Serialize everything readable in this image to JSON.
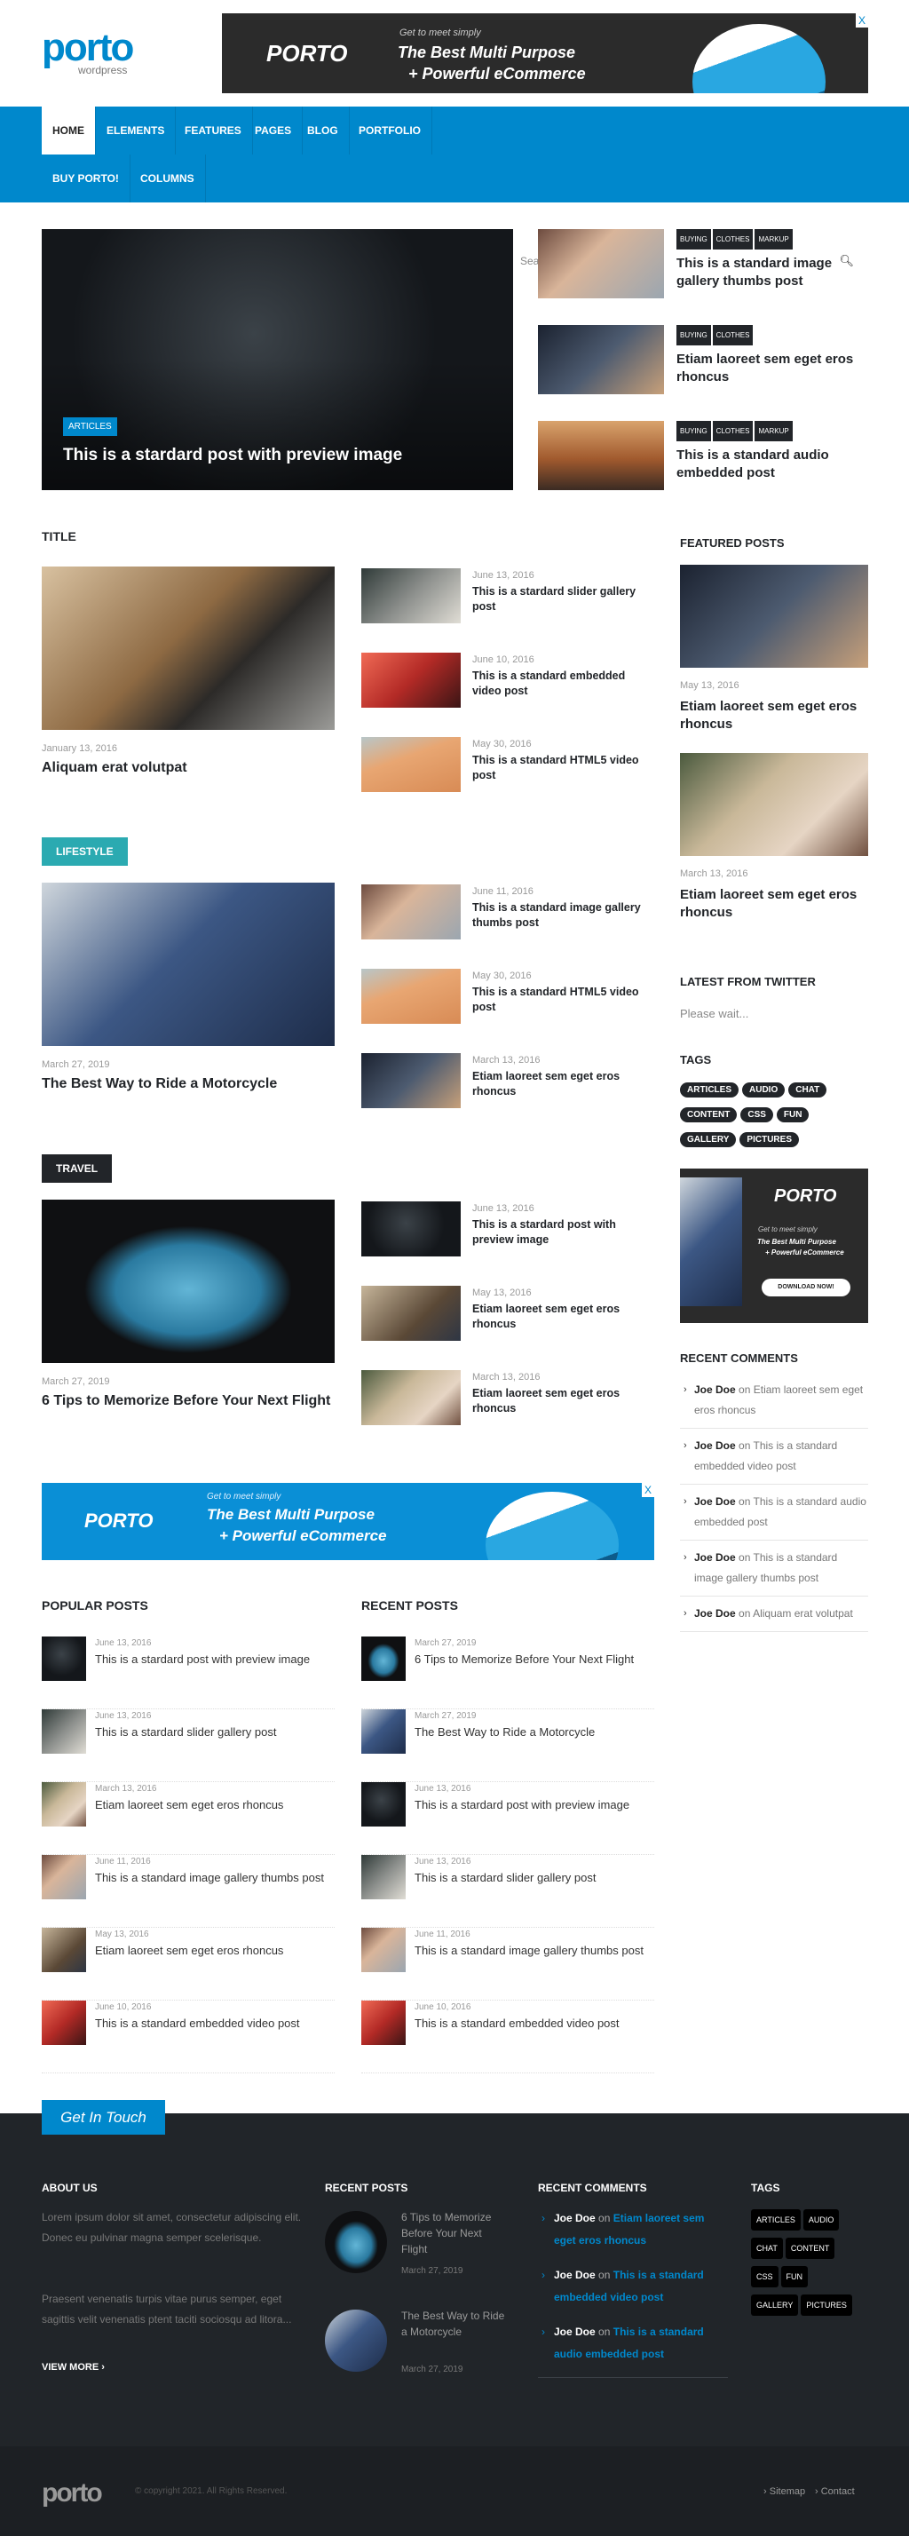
{
  "header": {
    "logo": "porto",
    "logo_sub": "wordpress",
    "ad": {
      "brand": "PORTO",
      "tagline": "Get to meet simply",
      "headline1": "The Best Multi Purpose",
      "headline2": "+ Powerful eCommerce",
      "close": "X"
    }
  },
  "nav": {
    "items": [
      "HOME",
      "ELEMENTS",
      "FEATURES",
      "PAGES",
      "BLOG",
      "PORTFOLIO",
      "BUY PORTO!",
      "COLUMNS"
    ],
    "active": "HOME",
    "search_placeholder": "Search...",
    "search_icon": "magnifier-icon"
  },
  "hero": {
    "main": {
      "category": "ARTICLES",
      "title": "This is a stardard post with preview image"
    },
    "side": [
      {
        "tags": [
          "BUYING",
          "CLOTHES",
          "MARKUP"
        ],
        "title": "This is a standard image gallery thumbs post"
      },
      {
        "tags": [
          "BUYING",
          "CLOTHES"
        ],
        "title": "Etiam laoreet sem eget eros rhoncus"
      },
      {
        "tags": [
          "BUYING",
          "CLOTHES",
          "MARKUP"
        ],
        "title": "This is a standard audio embedded post"
      }
    ]
  },
  "sections": [
    {
      "heading": "TITLE",
      "color": "",
      "main": {
        "date": "January 13, 2016",
        "title": "Aliquam erat volutpat"
      },
      "list": [
        {
          "date": "June 13, 2016",
          "title": "This is a stardard slider gallery post"
        },
        {
          "date": "June 10, 2016",
          "title": "This is a standard embedded video post"
        },
        {
          "date": "May 30, 2016",
          "title": "This is a standard HTML5 video post"
        }
      ]
    },
    {
      "heading": "LIFESTYLE",
      "color": "#2baab1",
      "main": {
        "date": "March 27, 2019",
        "title": "The Best Way to Ride a Motorcycle"
      },
      "list": [
        {
          "date": "June 11, 2016",
          "title": "This is a standard image gallery thumbs post"
        },
        {
          "date": "May 30, 2016",
          "title": "This is a standard HTML5 video post"
        },
        {
          "date": "March 13, 2016",
          "title": "Etiam laoreet sem eget eros rhoncus"
        }
      ]
    },
    {
      "heading": "TRAVEL",
      "color": "#222529",
      "main": {
        "date": "March 27, 2019",
        "title": "6 Tips to Memorize Before Your Next Flight"
      },
      "list": [
        {
          "date": "June 13, 2016",
          "title": "This is a stardard post with preview image"
        },
        {
          "date": "May 13, 2016",
          "title": "Etiam laoreet sem eget eros rhoncus"
        },
        {
          "date": "March 13, 2016",
          "title": "Etiam laoreet sem eget eros rhoncus"
        }
      ]
    }
  ],
  "popular": {
    "heading": "POPULAR POSTS",
    "items": [
      {
        "date": "June 13, 2016",
        "title": "This is a stardard post with preview image"
      },
      {
        "date": "June 13, 2016",
        "title": "This is a stardard slider gallery post"
      },
      {
        "date": "March 13, 2016",
        "title": "Etiam laoreet sem eget eros rhoncus"
      },
      {
        "date": "June 11, 2016",
        "title": "This is a standard image gallery thumbs post"
      },
      {
        "date": "May 13, 2016",
        "title": "Etiam laoreet sem eget eros rhoncus"
      },
      {
        "date": "June 10, 2016",
        "title": "This is a standard embedded video post"
      }
    ]
  },
  "recent": {
    "heading": "RECENT POSTS",
    "items": [
      {
        "date": "March 27, 2019",
        "title": "6 Tips to Memorize Before Your Next Flight"
      },
      {
        "date": "March 27, 2019",
        "title": "The Best Way to Ride a Motorcycle"
      },
      {
        "date": "June 13, 2016",
        "title": "This is a stardard post with preview image"
      },
      {
        "date": "June 13, 2016",
        "title": "This is a stardard slider gallery post"
      },
      {
        "date": "June 11, 2016",
        "title": "This is a standard image gallery thumbs post"
      },
      {
        "date": "June 10, 2016",
        "title": "This is a standard embedded video post"
      }
    ]
  },
  "sidebar": {
    "featured_heading": "FEATURED POSTS",
    "featured": [
      {
        "date": "May 13, 2016",
        "title": "Etiam laoreet sem eget eros rhoncus"
      },
      {
        "date": "March 13, 2016",
        "title": "Etiam laoreet sem eget eros rhoncus"
      }
    ],
    "twitter_heading": "LATEST FROM TWITTER",
    "twitter_text": "Please wait...",
    "tags_heading": "TAGS",
    "tags": [
      "ARTICLES",
      "AUDIO",
      "CHAT",
      "CONTENT",
      "CSS",
      "FUN",
      "GALLERY",
      "PICTURES"
    ],
    "ad": {
      "brand": "PORTO",
      "tagline": "Get to meet simply",
      "headline1": "The Best Multi Purpose",
      "headline2": "+ Powerful eCommerce",
      "button": "DOWNLOAD NOW!"
    },
    "comments_heading": "RECENT COMMENTS",
    "comments": [
      {
        "author": "Joe Doe",
        "on": "on",
        "post": "Etiam laoreet sem eget eros rhoncus"
      },
      {
        "author": "Joe Doe",
        "on": "on",
        "post": "This is a standard embedded video post"
      },
      {
        "author": "Joe Doe",
        "on": "on",
        "post": "This is a standard audio embedded post"
      },
      {
        "author": "Joe Doe",
        "on": "on",
        "post": "This is a standard image gallery thumbs post"
      },
      {
        "author": "Joe Doe",
        "on": "on",
        "post": "Aliquam erat volutpat"
      }
    ]
  },
  "footer": {
    "ribbon": "Get In Touch",
    "about_heading": "ABOUT US",
    "about_p1": "Lorem ipsum dolor sit amet, consectetur adipiscing elit. Donec eu pulvinar magna semper scelerisque.",
    "about_p2": "Praesent venenatis turpis vitae purus semper, eget sagittis velit venenatis ptent taciti sociosqu ad litora...",
    "view_more": "VIEW MORE",
    "recent_heading": "RECENT POSTS",
    "recent": [
      {
        "title": "6 Tips to Memorize Before Your Next Flight",
        "date": "March 27, 2019"
      },
      {
        "title": "The Best Way to Ride a Motorcycle",
        "date": "March 27, 2019"
      }
    ],
    "comments_heading": "RECENT COMMENTS",
    "comments": [
      {
        "author": "Joe Doe",
        "on": "on",
        "post": "Etiam laoreet sem eget eros rhoncus"
      },
      {
        "author": "Joe Doe",
        "on": "on",
        "post": "This is a standard embedded video post"
      },
      {
        "author": "Joe Doe",
        "on": "on",
        "post": "This is a standard audio embedded post"
      }
    ],
    "tags_heading": "TAGS",
    "tags": [
      "ARTICLES",
      "AUDIO",
      "CHAT",
      "CONTENT",
      "CSS",
      "FUN",
      "GALLERY",
      "PICTURES"
    ],
    "logo": "porto",
    "copyright": "© copyright 2021. All Rights Reserved.",
    "links": [
      "Sitemap",
      "Contact"
    ]
  },
  "colors": {
    "brand": "#0088cc",
    "dark": "#222529",
    "lifestyle": "#2baab1",
    "footer_bg": "#212529"
  }
}
